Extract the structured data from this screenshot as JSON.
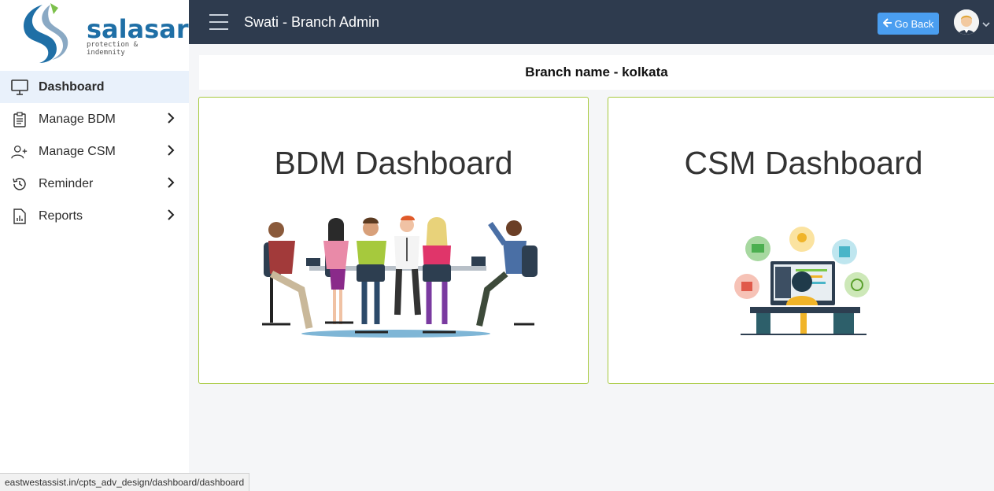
{
  "brand": {
    "name": "salasar",
    "tagline": "protection & indemnity",
    "color": "#1f6fa6"
  },
  "header": {
    "title": "Swati - Branch Admin",
    "go_back_label": "Go Back",
    "go_back_icon": "arrow-left-icon",
    "background": "#2e3b4e"
  },
  "sidebar": {
    "items": [
      {
        "label": "Dashboard",
        "icon": "monitor-icon",
        "active": true
      },
      {
        "label": "Manage BDM",
        "icon": "clipboard-icon",
        "has_submenu": true
      },
      {
        "label": "Manage CSM",
        "icon": "user-plus-icon",
        "has_submenu": true
      },
      {
        "label": "Reminder",
        "icon": "history-icon",
        "has_submenu": true
      },
      {
        "label": "Reports",
        "icon": "report-icon",
        "has_submenu": true
      }
    ]
  },
  "main": {
    "branch_label": "Branch name - kolkata",
    "cards": [
      {
        "title": "BDM Dashboard",
        "illustration": "team-meeting-illustration"
      },
      {
        "title": "CSM Dashboard",
        "illustration": "developer-workspace-illustration"
      }
    ],
    "card_border_color": "#a6c93d"
  },
  "status_bar": {
    "url": "eastwestassist.in/cpts_adv_design/dashboard/dashboard"
  }
}
